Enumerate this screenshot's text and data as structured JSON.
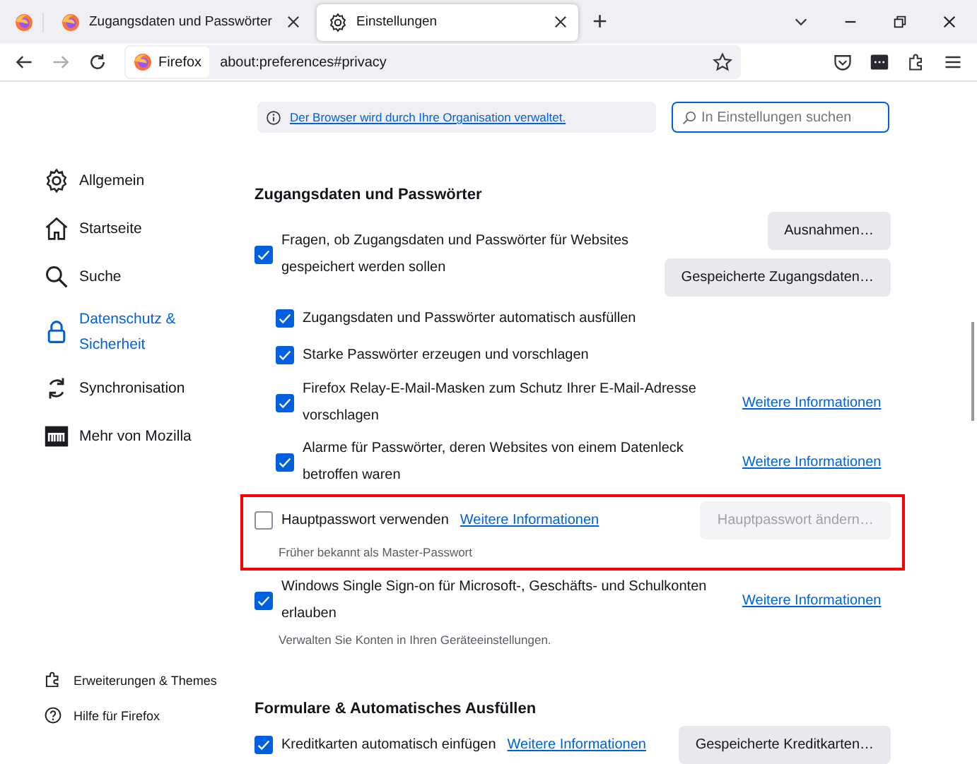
{
  "tabs": [
    {
      "label": "Zugangsdaten und Passwörter",
      "selected": false
    },
    {
      "label": "Einstellungen",
      "selected": true
    }
  ],
  "new_tab": "+",
  "address_bar": {
    "identity": "Firefox",
    "url": "about:preferences#privacy"
  },
  "sidebar": {
    "items": [
      {
        "label": "Allgemein",
        "selected": false
      },
      {
        "label": "Startseite",
        "selected": false
      },
      {
        "label": "Suche",
        "selected": false
      },
      {
        "label": "Datenschutz & Sicherheit",
        "selected": true
      },
      {
        "label": "Synchronisation",
        "selected": false
      },
      {
        "label": "Mehr von Mozilla",
        "selected": false
      }
    ],
    "footer": [
      {
        "label": "Erweiterungen & Themes"
      },
      {
        "label": "Hilfe für Firefox"
      }
    ]
  },
  "policy_notice": "Der Browser wird durch Ihre Organisation verwaltet.",
  "search": {
    "placeholder": "In Einstellungen suchen"
  },
  "sections": [
    {
      "title": "Zugangsdaten und Passwörter",
      "items": [
        {
          "label": "Fragen, ob Zugangsdaten und Passwörter für Websites gespeichert werden sollen",
          "checked": true,
          "buttons": [
            {
              "label": "Ausnahmen…",
              "disabled": false
            },
            {
              "label": "Gespeicherte Zugangsdaten…",
              "disabled": false
            }
          ],
          "children": [
            {
              "label": "Zugangsdaten und Passwörter automatisch ausfüllen",
              "checked": true
            },
            {
              "label": "Starke Passwörter erzeugen und vorschlagen",
              "checked": true
            },
            {
              "label": "Firefox Relay-E-Mail-Masken zum Schutz Ihrer E-Mail-Adresse vorschlagen",
              "checked": true,
              "link": "Weitere Informationen"
            },
            {
              "label": "Alarme für Passwörter, deren Websites von einem Datenleck betroffen waren",
              "checked": true,
              "link": "Weitere Informationen"
            }
          ]
        },
        {
          "label": "Hauptpasswort verwenden",
          "checked": false,
          "inline_link": "Weitere Informationen",
          "buttons": [
            {
              "label": "Hauptpasswort ändern…",
              "disabled": true
            }
          ],
          "note": "Früher bekannt als Master-Passwort",
          "highlighted": true
        },
        {
          "label": "Windows Single Sign-on für Microsoft-, Geschäfts- und Schulkonten erlauben",
          "checked": true,
          "link": "Weitere Informationen",
          "note": "Verwalten Sie Konten in Ihren Geräteeinstellungen."
        }
      ]
    },
    {
      "title": "Formulare & Automatisches Ausfüllen",
      "items": [
        {
          "label": "Kreditkarten automatisch einfügen",
          "checked": true,
          "inline_link": "Weitere Informationen",
          "buttons": [
            {
              "label": "Gespeicherte Kreditkarten…",
              "disabled": false
            }
          ]
        }
      ]
    }
  ]
}
